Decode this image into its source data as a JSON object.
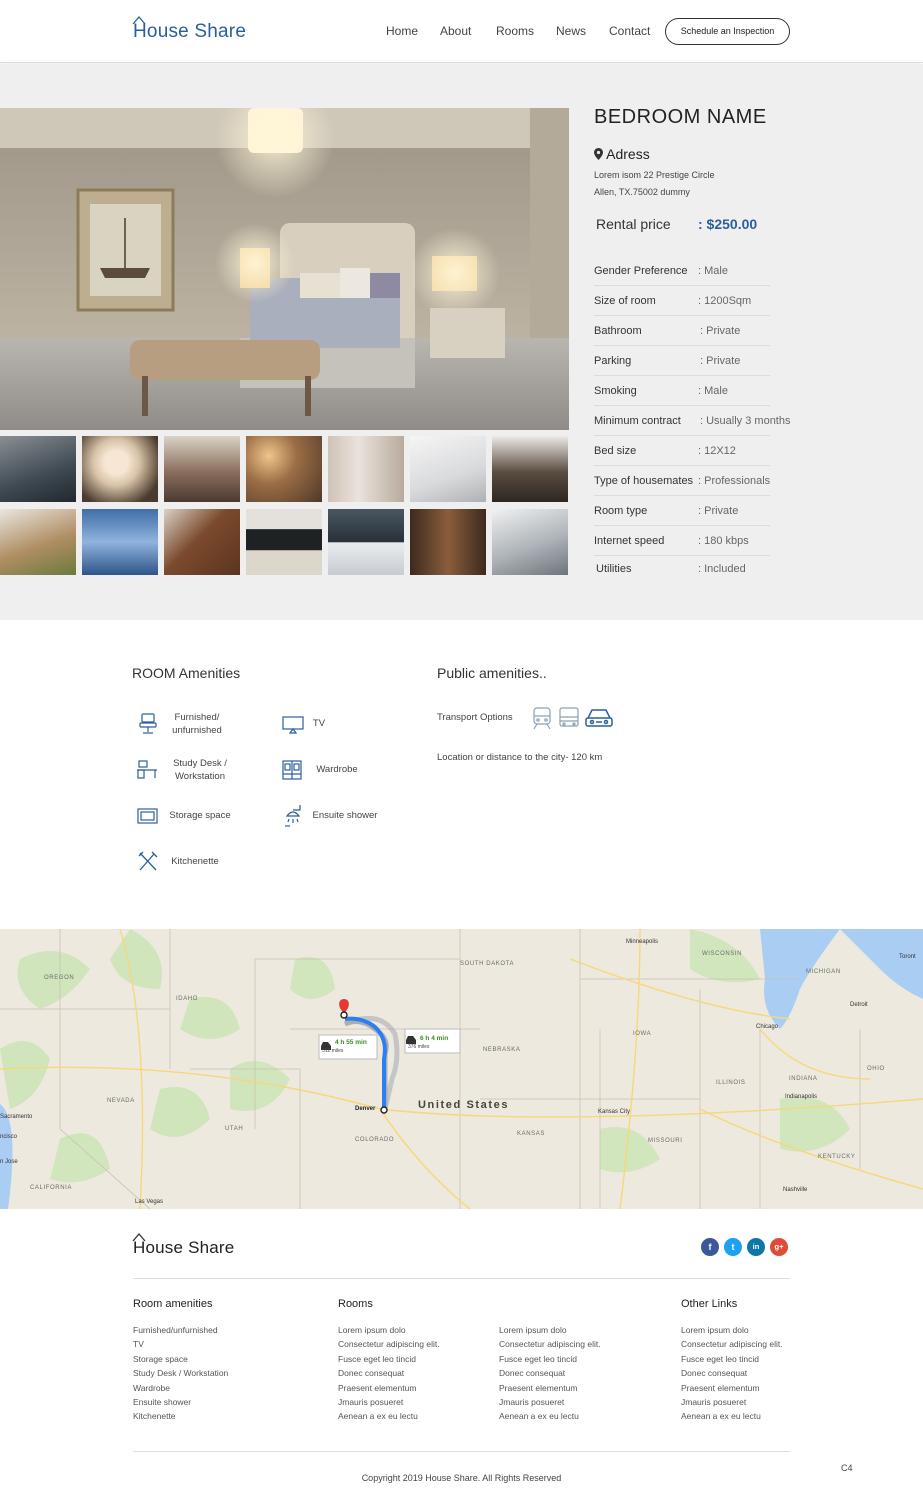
{
  "header": {
    "logo": "House Share",
    "nav": [
      "Home",
      "About",
      "Rooms",
      "News",
      "Contact"
    ],
    "cta": "Schedule an Inspection"
  },
  "room": {
    "title": "BEDROOM NAME",
    "address_label": "Adress",
    "address_line1": "Lorem isom 22 Prestige Circle",
    "address_line2": "Allen, TX.75002 dummy",
    "rental_label": "Rental price",
    "rental_value": ": $250.00",
    "details": [
      {
        "key": "Gender Preference",
        "value": ": Male"
      },
      {
        "key": "Size of room",
        "value": ": 1200Sqm"
      },
      {
        "key": "Bathroom",
        "value": ": Private"
      },
      {
        "key": "Parking",
        "value": ": Private"
      },
      {
        "key": "Smoking",
        "value": ": Male"
      },
      {
        "key": "Minimum contract",
        "value": ": Usually 3 months"
      },
      {
        "key": "Bed size",
        "value": ": 12X12"
      },
      {
        "key": "Type of housemates",
        "value": ": Professionals"
      },
      {
        "key": "Room type",
        "value": ": Private"
      },
      {
        "key": "Internet speed",
        "value": ": 180 kbps"
      },
      {
        "key": "Utilities",
        "value": ": Included"
      }
    ]
  },
  "amenities": {
    "room_title": "ROOM Amenities",
    "public_title": "Public amenities..",
    "items": [
      "Furnished/ unfurnished",
      "TV",
      "Study Desk / Workstation",
      "Wardrobe",
      "Storage space",
      "Ensuite shower",
      "Kitchenette"
    ],
    "transport_label": "Transport Options",
    "location_text": "Location or distance to the city- 120 km"
  },
  "map": {
    "country": "United States",
    "route1_time": "4 h 55 min",
    "route1_dist": "312 miles",
    "route2_time": "6 h 4 min",
    "route2_dist": "376 miles",
    "labels": {
      "minneapolis": "Minneapolis",
      "wisconsin": "WISCONSIN",
      "south_dakota": "SOUTH DAKOTA",
      "michigan": "MICHIGAN",
      "toronto": "Toront",
      "oregon": "OREGON",
      "idaho": "IDAHO",
      "detroit": "Detroit",
      "iowa": "IOWA",
      "chicago": "Chicago",
      "nebraska": "NEBRASKA",
      "ohio": "OHIO",
      "illinois": "ILLINOIS",
      "indiana": "INDIANA",
      "indianapolis": "Indianapolis",
      "nevada": "NEVADA",
      "sacramento": "Sacramento",
      "denver": "Denver",
      "kansas_city": "Kansas City",
      "utah": "UTAH",
      "cisco": "ncisco",
      "kansas": "KANSAS",
      "missouri": "MISSOURI",
      "colorado": "COLORADO",
      "kentucky": "KENTUCKY",
      "san_jose": "n Jose",
      "california": "CALIFORNIA",
      "nashville": "Nashville",
      "las_vegas": "Las Vegas"
    }
  },
  "footer": {
    "logo": "House Share",
    "col1_title": "Room amenities",
    "col1": [
      "Furnished/unfurnished",
      "TV",
      "Storage space",
      "Study Desk / Workstation",
      "Wardrobe",
      "Ensuite shower",
      "Kitchenette"
    ],
    "col2_title": "Rooms",
    "col2": [
      "Lorem ipsum dolo",
      "Consectetur adipiscing elit.",
      "Fusce eget leo tincid",
      "Donec consequat",
      "Praesent elementum",
      "Jmauris posueret",
      "Aenean a ex eu lectu"
    ],
    "col3": [
      "Lorem ipsum dolo",
      "Consectetur adipiscing elit.",
      "Fusce eget leo tincid",
      "Donec consequat",
      "Praesent elementum",
      "Jmauris posueret",
      "Aenean a ex eu lectu"
    ],
    "col4_title": "Other Links",
    "col4": [
      "Lorem ipsum dolo",
      "Consectetur adipiscing elit.",
      "Fusce eget leo tincid",
      "Donec consequat",
      "Praesent elementum",
      "Jmauris posueret",
      "Aenean a ex eu lectu"
    ],
    "social": [
      "f",
      "t",
      "in",
      "g+"
    ],
    "copyright": "Copyright 2019 House Share. All Rights Reserved",
    "code": "C4"
  },
  "colors": {
    "brand": "#2a5f9e",
    "price": "#2a5f9e",
    "facebook": "#3b5998",
    "twitter": "#1da1f2",
    "linkedin": "#0e76a8",
    "google": "#dd4b39"
  }
}
